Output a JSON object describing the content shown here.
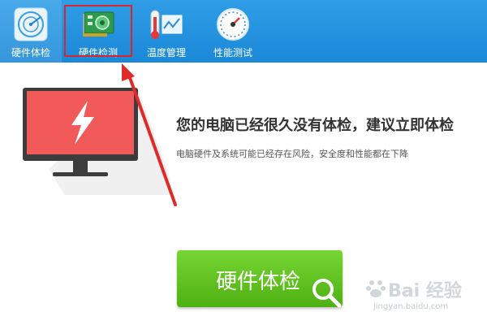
{
  "toolbar": {
    "tabs": [
      {
        "label": "硬件体检",
        "icon": "radar-icon"
      },
      {
        "label": "硬件检测",
        "icon": "circuit-board-icon"
      },
      {
        "label": "温度管理",
        "icon": "thermometer-chart-icon"
      },
      {
        "label": "性能测试",
        "icon": "speedometer-icon"
      }
    ],
    "active_tab": "硬件体检",
    "highlighted_tab": "硬件检测"
  },
  "main": {
    "illustration": "monitor-lightning-icon",
    "headline": "您的电脑已经很久没有体检，建议立即体检",
    "subline": "电脑硬件及系统可能已经存在风险，安全度和性能都在下降",
    "cta_label": "硬件体检",
    "cta_icon": "magnifier-icon"
  },
  "annotation": {
    "highlight_color": "#d9252c",
    "arrow_color": "#e02a2a"
  },
  "watermark": {
    "text": "Bai 经验",
    "url": "jingyan.baidu.com"
  },
  "colors": {
    "toolbar": "#1b88d8",
    "cta": "#5cbd1c",
    "monitor_screen": "#f25a5a"
  }
}
